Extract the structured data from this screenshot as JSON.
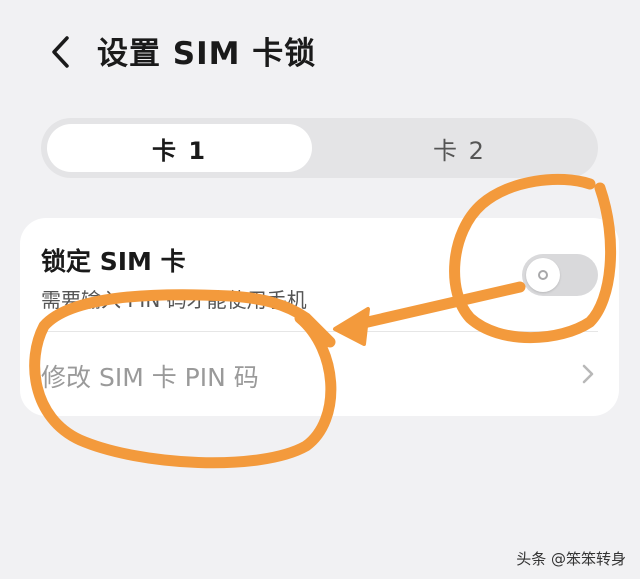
{
  "header": {
    "title": "设置 SIM 卡锁",
    "back_icon": "chevron-left-icon"
  },
  "tabs": [
    {
      "label": "卡 1",
      "selected": true
    },
    {
      "label": "卡 2",
      "selected": false
    }
  ],
  "settings": {
    "lock_sim": {
      "title": "锁定 SIM 卡",
      "subtitle": "需要输入 PIN 码才能使用手机",
      "enabled": false
    },
    "change_pin": {
      "label": "修改 SIM 卡 PIN 码",
      "enabled": false,
      "icon": "chevron-right-icon"
    }
  },
  "annotation": {
    "color": "#f39a3c"
  },
  "watermark": {
    "text": "头条 @笨笨转身"
  }
}
